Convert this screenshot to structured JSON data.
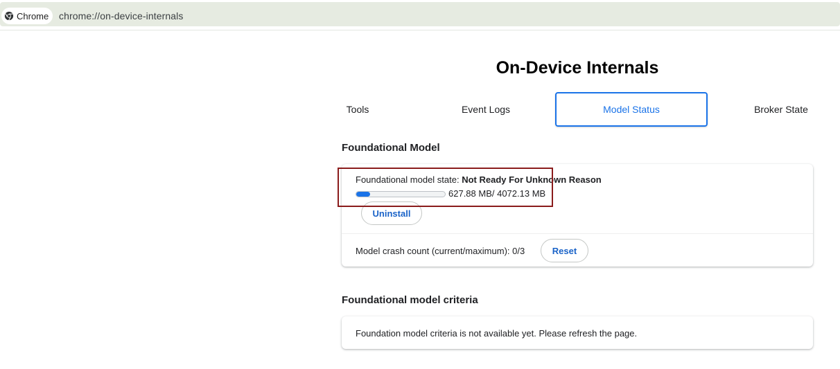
{
  "browser": {
    "chip_label": "Chrome",
    "url": "chrome://on-device-internals"
  },
  "page": {
    "title": "On-Device Internals"
  },
  "tabs": [
    {
      "label": "Tools",
      "selected": false
    },
    {
      "label": "Event Logs",
      "selected": false
    },
    {
      "label": "Model Status",
      "selected": true
    },
    {
      "label": "Broker State",
      "selected": false
    }
  ],
  "foundational_model": {
    "section_title": "Foundational Model",
    "state_label": "Foundational model state: ",
    "state_value": "Not Ready For Unknown Reason",
    "download_progress": 0.154,
    "download_text": "627.88 MB/ 4072.13 MB",
    "uninstall_label": "Uninstall",
    "crash_count_text": "Model crash count (current/maximum): 0/3",
    "reset_label": "Reset"
  },
  "criteria": {
    "section_title": "Foundational model criteria",
    "message": "Foundation model criteria is not available yet. Please refresh the page."
  },
  "colors": {
    "accent": "#1a73e8",
    "omnibox_bg": "#e6ebe1",
    "annotation_border": "#8a1b1b"
  }
}
